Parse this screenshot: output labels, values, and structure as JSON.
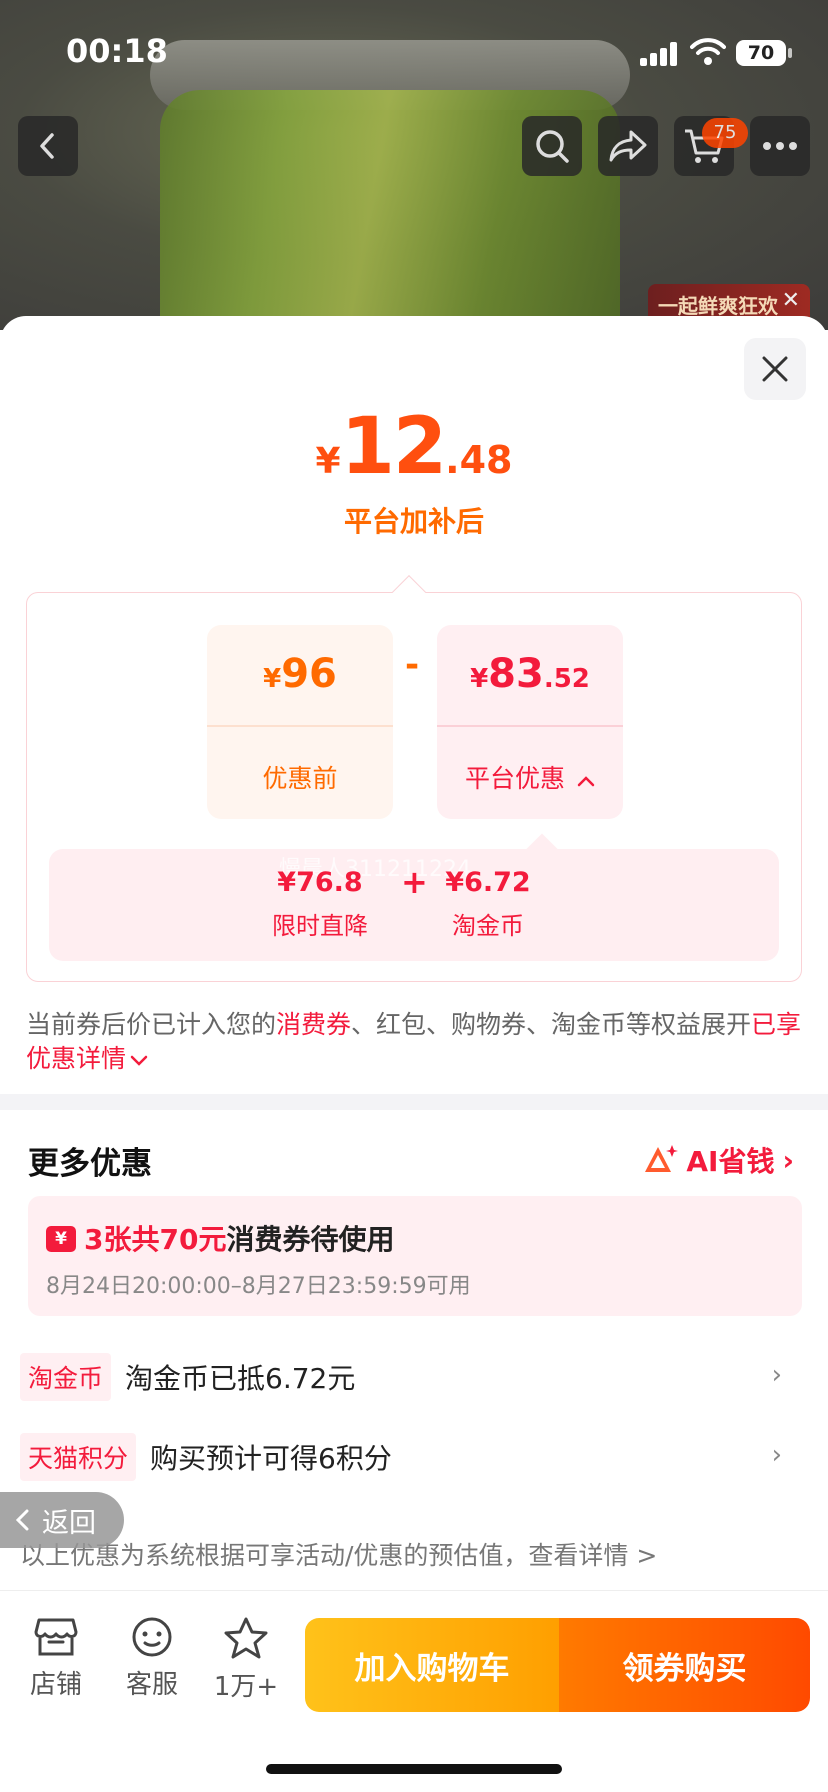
{
  "status_bar": {
    "time": "00:18",
    "battery": "70"
  },
  "nav": {
    "cart_count": "75"
  },
  "promo": {
    "text": "一起鲜爽狂欢"
  },
  "price": {
    "currency": "¥",
    "final_int": "12",
    "final_dec": ".48",
    "final_label": "平台加补后",
    "before_int": "96",
    "before_label": "优惠前",
    "minus": "-",
    "discount_int": "83",
    "discount_dec": ".52",
    "discount_label": "平台优惠",
    "breakdown": [
      {
        "value": "¥76.8",
        "label": "限时直降"
      },
      {
        "value": "¥6.72",
        "label": "淘金币"
      }
    ],
    "plus": "+",
    "watermark": "慢晨人311211224"
  },
  "note": {
    "part1": "当前券后价已计入您的",
    "highlight1": "消费券",
    "part2": "、红包、购物券、淘金币等权益展开",
    "link": "已享优惠详情"
  },
  "more": {
    "title": "更多优惠",
    "ai_label": "AI省钱",
    "coupon": {
      "icon": "¥",
      "highlight": "3张共70元",
      "text": "消费券待使用",
      "validity": "8月24日20:00:00–8月27日23:59:59可用"
    },
    "benefits": [
      {
        "tag": "淘金币",
        "text": "淘金币已抵6.72元"
      },
      {
        "tag": "天猫积分",
        "text": "购买预计可得6积分"
      }
    ],
    "back_label": "返回",
    "disclaimer": "以上优惠为系统根据可享活动/优惠的预估值，查看详情 >"
  },
  "bottom_bar": {
    "store": "店铺",
    "service": "客服",
    "favorites": "1万+",
    "add_cart": "加入购物车",
    "buy": "领券购买"
  }
}
